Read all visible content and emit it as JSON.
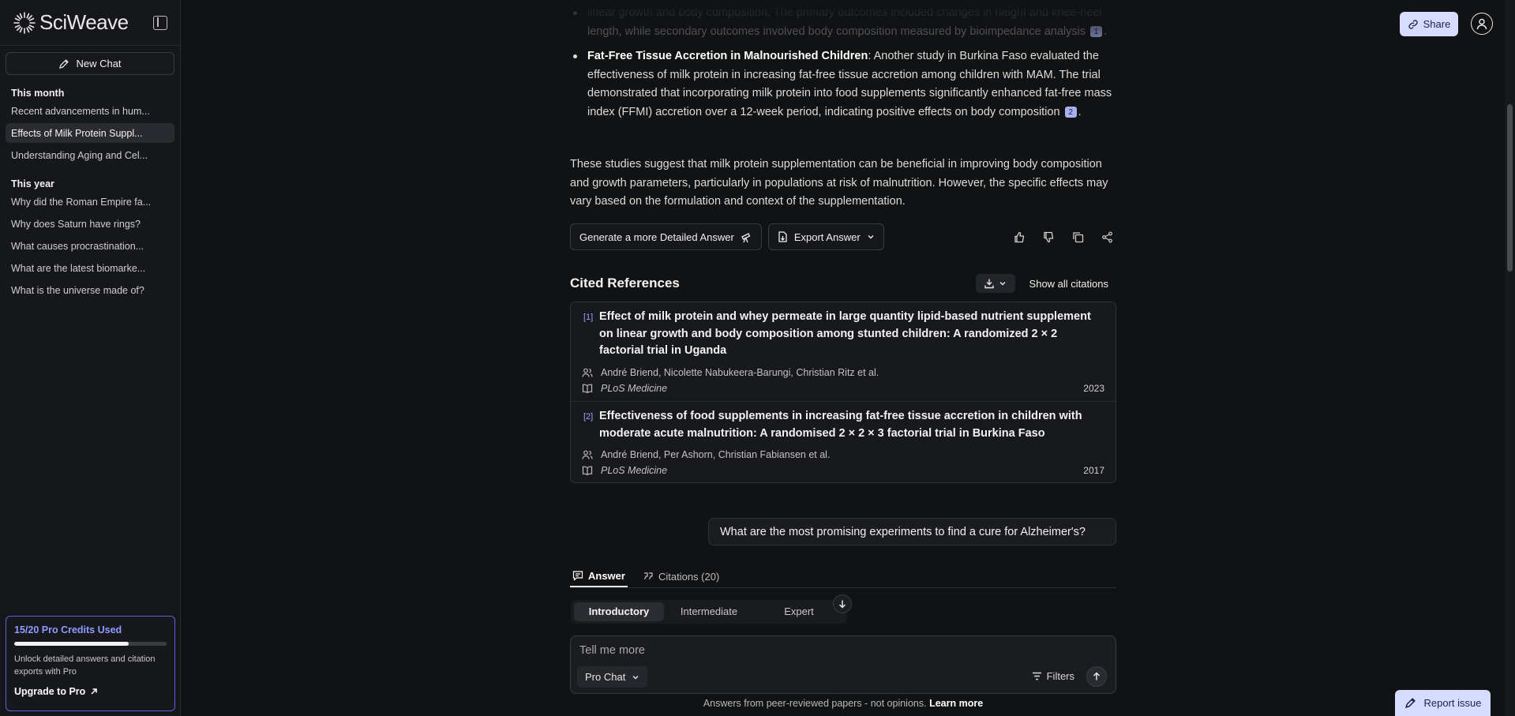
{
  "brand": {
    "name": "SciWeave"
  },
  "sidebar": {
    "new_chat": "New Chat",
    "sections": [
      {
        "label": "This month",
        "items": [
          "Recent advancements in hum...",
          "Effects of Milk Protein Suppl...",
          "Understanding Aging and Cel..."
        ]
      },
      {
        "label": "This year",
        "items": [
          "Why did the Roman Empire fa...",
          "Why does Saturn have rings?",
          "What causes procrastination...",
          "What are the latest biomarke...",
          "What is the universe made of?"
        ]
      }
    ],
    "active_item": "Effects of Milk Protein Suppl...",
    "pro": {
      "title": "15/20 Pro Credits Used",
      "used": 15,
      "total": 20,
      "desc": "Unlock detailed answers and citation exports with Pro",
      "upgrade": "Upgrade to Pro"
    }
  },
  "header": {
    "share": "Share"
  },
  "answer": {
    "faded_line1": "linear growth and body composition. The primary outcomes included changes in height and knee-heel",
    "faded_line2": "length, while secondary outcomes involved body composition measured by bioimpedance analysis",
    "faded_cite": "1",
    "bullet_title": "Fat-Free Tissue Accretion in Malnourished Children",
    "bullet_text": ": Another study in Burkina Faso evaluated the effectiveness of milk protein in increasing fat-free tissue accretion among children with MAM. The trial demonstrated that incorporating milk protein into food supplements significantly enhanced fat-free mass index (FFMI) accretion over a 12-week period, indicating positive effects on body composition",
    "bullet_cite": "2",
    "summary": "These studies suggest that milk protein supplementation can be beneficial in improving body composition and growth parameters, particularly in populations at risk of malnutrition. However, the specific effects may vary based on the formulation and context of the supplementation.",
    "detailed_btn": "Generate a more Detailed Answer",
    "export_btn": "Export Answer"
  },
  "references": {
    "title": "Cited References",
    "show_all": "Show all citations",
    "items": [
      {
        "num": "[1]",
        "title": "Effect of milk protein and whey permeate in large quantity lipid-based nutrient supplement on linear growth and body composition among stunted children: A randomized 2 × 2 factorial trial in Uganda",
        "authors": "André Briend, Nicolette Nabukeera-Barungi, Christian Ritz et al.",
        "journal": "PLoS Medicine",
        "year": "2023"
      },
      {
        "num": "[2]",
        "title": "Effectiveness of food supplements in increasing fat-free tissue accretion in children with moderate acute malnutrition: A randomised 2 × 2 × 3 factorial trial in Burkina Faso",
        "authors": "André Briend, Per Ashorn, Christian Fabiansen et al.",
        "journal": "PLoS Medicine",
        "year": "2017"
      }
    ]
  },
  "question": "What are the most promising experiments to find a cure for Alzheimer's?",
  "tabs": {
    "answer": "Answer",
    "citations": "Citations (20)"
  },
  "levels": [
    "Introductory",
    "Intermediate",
    "Expert"
  ],
  "composer": {
    "placeholder": "Tell me more",
    "mode": "Pro Chat",
    "filters": "Filters"
  },
  "footer": {
    "note": "Answers from peer-reviewed papers - not opinions.",
    "learn_more": "Learn more"
  },
  "report": "Report issue"
}
